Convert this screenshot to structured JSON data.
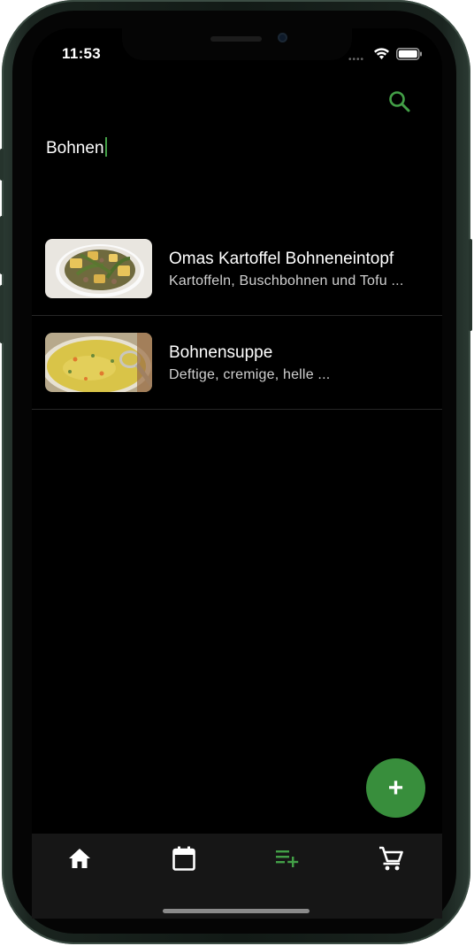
{
  "status_bar": {
    "time": "11:53",
    "signal_icon": "cellular-dots-icon",
    "wifi_icon": "wifi-icon",
    "battery_icon": "battery-icon"
  },
  "header": {
    "search_icon": "search-icon",
    "search_value": "Bohnen"
  },
  "results": [
    {
      "title": "Omas Kartoffel Bohneneintopf",
      "subtitle": "Kartoffeln, Buschbohnen und Tofu ..."
    },
    {
      "title": "Bohnensuppe",
      "subtitle": "Deftige, cremige, helle ..."
    }
  ],
  "fab": {
    "icon": "add-icon",
    "label": "+"
  },
  "bottom_nav": {
    "items": [
      {
        "icon": "home-icon",
        "active": false
      },
      {
        "icon": "calendar-icon",
        "active": false
      },
      {
        "icon": "playlist-add-icon",
        "active": true
      },
      {
        "icon": "shopping-cart-icon",
        "active": false
      }
    ]
  },
  "colors": {
    "accent": "#43a047",
    "fab": "#388e3c",
    "background": "#000000",
    "nav_background": "#161616",
    "divider": "#262626"
  }
}
